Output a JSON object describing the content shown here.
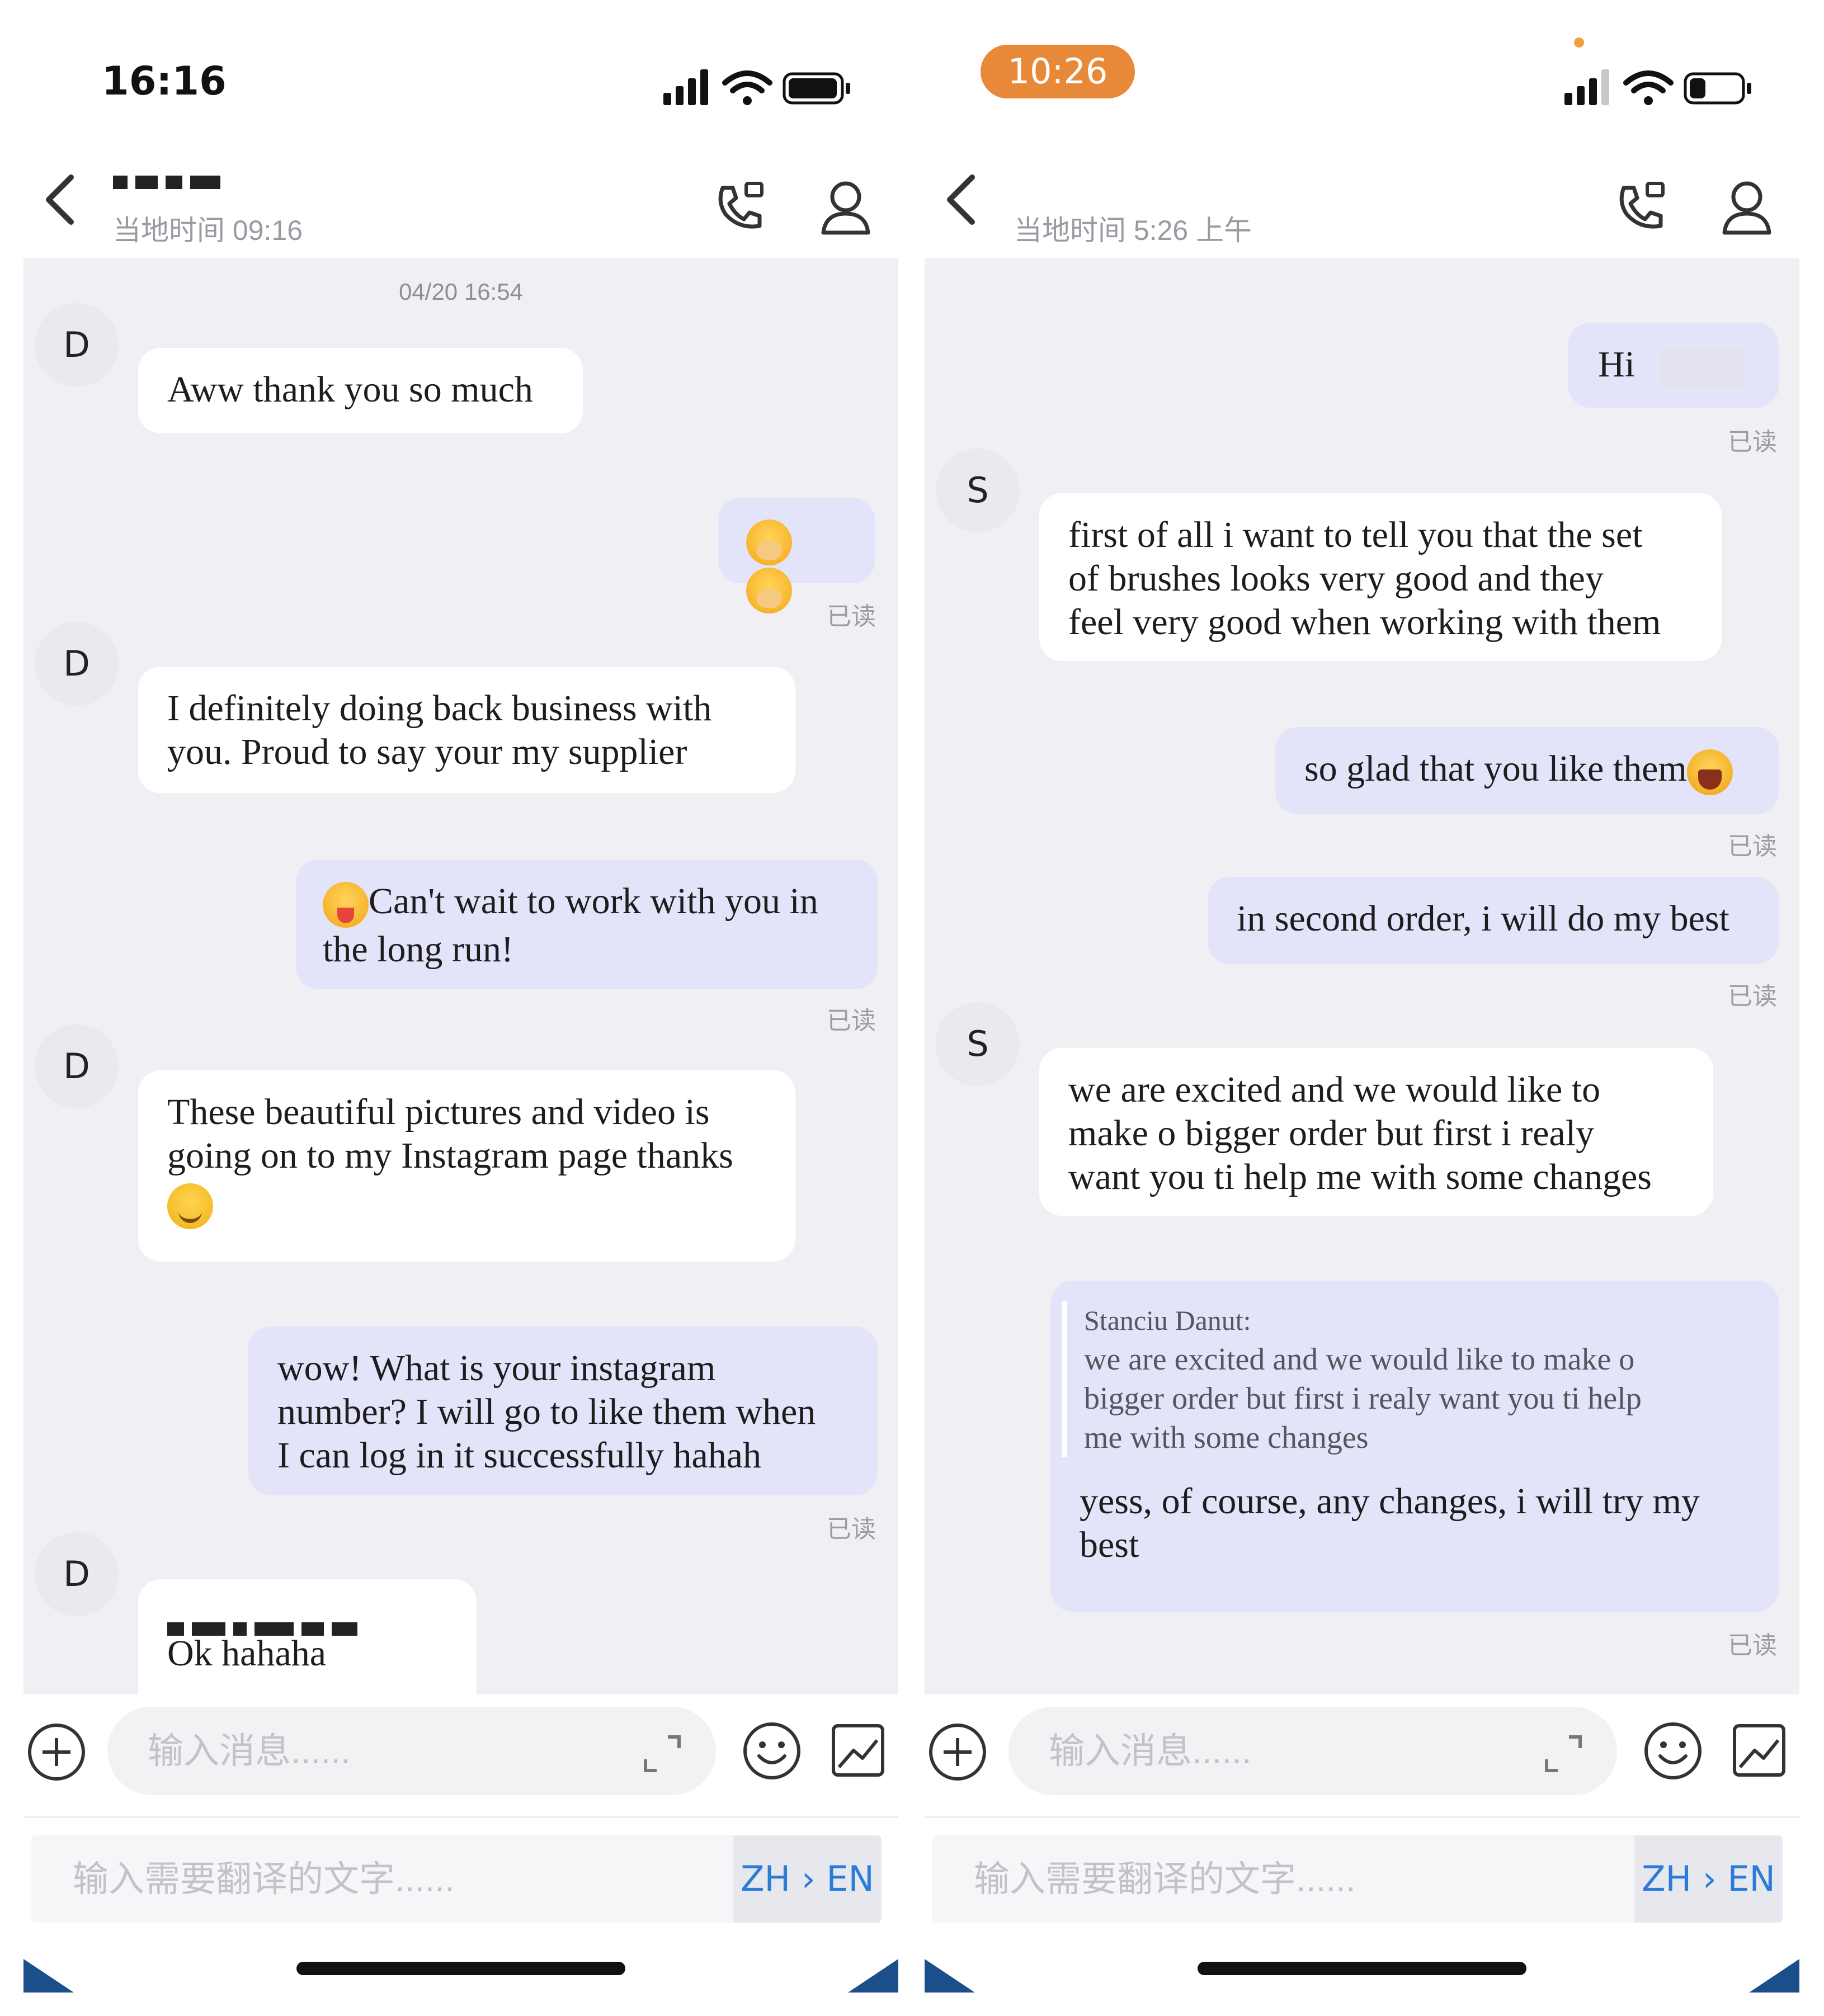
{
  "left": {
    "status_time": "16:16",
    "header": {
      "contact_name": "",
      "local_time": "当地时间 09:16"
    },
    "timestamp": "04/20 16:54",
    "messages": [
      {
        "avatar": "D",
        "text": "Aww thank you so much"
      },
      {
        "emoji_pair": "shy-face"
      },
      {
        "avatar": "D",
        "line1": "I definitely doing back business with",
        "line2": "you. Proud to say your my supplier"
      },
      {
        "line1": "Can't wait to work with you in",
        "line2": "the long run!"
      },
      {
        "avatar": "D",
        "line1": "These beautiful pictures and video is",
        "line2": "going on to my Instagram page thanks"
      },
      {
        "line1": "wow! What is your instagram",
        "line2": "number? I will go to like them when",
        "line3": "I can log in it successfully hahah"
      },
      {
        "avatar": "D",
        "text": "Ok hahaha"
      }
    ],
    "read_label": "已读",
    "input_placeholder": "输入消息......",
    "translate_placeholder": "输入需要翻译的文字......",
    "lang_label": "ZH › EN"
  },
  "right": {
    "status_time": "10:26",
    "header": {
      "local_time": "当地时间 5:26 上午"
    },
    "messages": [
      {
        "text": "Hi"
      },
      {
        "avatar": "S",
        "line1": "first of all i want to tell you that the set",
        "line2": "of brushes looks very good and they",
        "line3": "feel very good when working with them"
      },
      {
        "text": "so glad that you like them"
      },
      {
        "text": "in second order, i will do my best"
      },
      {
        "avatar": "S",
        "line1": "we are excited and we would like to",
        "line2": "make o bigger order but first i realy",
        "line3": "want you ti help me with some changes"
      },
      {
        "quote_author": "Stanciu Danut:",
        "quote_line1": "we are excited and we would like to make o",
        "quote_line2": "bigger order but first i realy want you ti help",
        "quote_line3": "me with some changes",
        "line1": "yess, of course, any changes, i will try my",
        "line2": "best"
      }
    ],
    "read_label": "已读",
    "input_placeholder": "输入消息......",
    "translate_placeholder": "输入需要翻译的文字......",
    "lang_label": "ZH › EN"
  },
  "colors": {
    "accent": "#2b7cd6",
    "outgoing_bubble": "#e3e3fa",
    "chat_bg": "#f0f0f4",
    "status_pill": "#e8893a"
  }
}
